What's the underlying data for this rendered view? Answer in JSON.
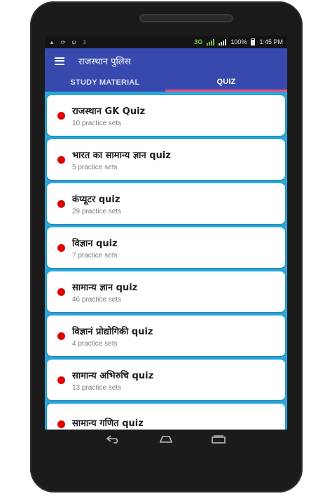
{
  "status_bar": {
    "network": "3G",
    "battery": "100%",
    "time": "1:45",
    "time_suffix": "PM",
    "icons": [
      "notification-icon",
      "sync-icon",
      "usb-icon",
      "download-icon",
      "wifi-icon",
      "signal-icon",
      "battery-icon"
    ]
  },
  "toolbar": {
    "title": "राजस्थान पुलिस",
    "menu_icon": "hamburger-menu-icon"
  },
  "tabs": [
    {
      "label": "STUDY MATERIAL",
      "active": false
    },
    {
      "label": "QUIZ",
      "active": true
    }
  ],
  "quiz_list": [
    {
      "title": "राजस्थान GK Quiz",
      "subtitle": "10 practice sets"
    },
    {
      "title": "भारत का सामान्य ज्ञान quiz",
      "subtitle": "5 practice sets"
    },
    {
      "title": "कंप्यूटर quiz",
      "subtitle": "29 practice sets"
    },
    {
      "title": "विज्ञान quiz",
      "subtitle": "7 practice sets"
    },
    {
      "title": "सामान्य ज्ञान quiz",
      "subtitle": "46 practice sets"
    },
    {
      "title": "विज्ञानं प्रोद्योगिकी quiz",
      "subtitle": "4 practice sets"
    },
    {
      "title": "सामान्य अभिरुचि quiz",
      "subtitle": "13 practice sets"
    },
    {
      "title": "सामान्य गणित quiz",
      "subtitle": ""
    }
  ],
  "nav_bar": [
    "back-icon",
    "home-icon",
    "recent-apps-icon"
  ],
  "colors": {
    "app_bar": "#3849ad",
    "background": "#2aa7dc",
    "tab_indicator": "#f04a7a",
    "bullet": "#e00000"
  }
}
